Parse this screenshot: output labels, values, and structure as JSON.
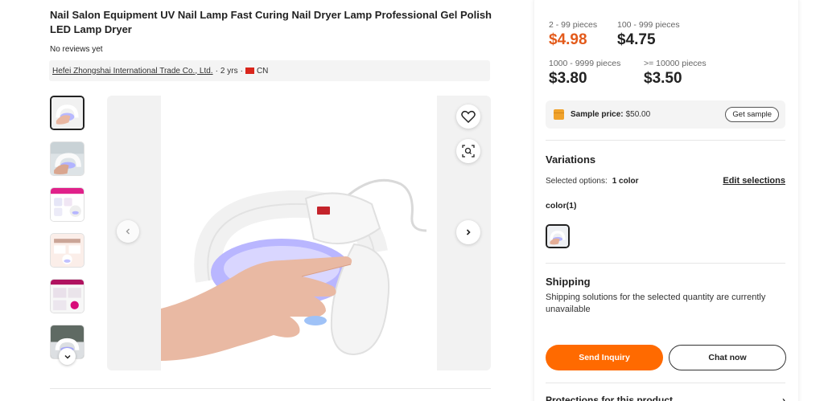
{
  "product": {
    "title": "Nail Salon Equipment UV Nail Lamp Fast Curing Nail Dryer Lamp Professional Gel Polish LED Lamp Dryer",
    "reviews": "No reviews yet"
  },
  "supplier": {
    "name": "Hefei Zhongshai International Trade Co., Ltd.",
    "years": "2 yrs",
    "country": "CN",
    "separator": "·"
  },
  "gallery": {
    "thumbnails": [
      "thumb-1",
      "thumb-2",
      "thumb-3",
      "thumb-4",
      "thumb-5",
      "thumb-6"
    ],
    "selected_index": 0,
    "icons": {
      "favorite": "heart-icon",
      "image_search": "lens-icon",
      "prev": "chevron-left-icon",
      "next": "chevron-right-icon",
      "more": "chevron-down-icon"
    }
  },
  "pricing": {
    "tiers": [
      {
        "range": "2 - 99 pieces",
        "price": "$4.98"
      },
      {
        "range": "100 - 999 pieces",
        "price": "$4.75"
      },
      {
        "range": "1000 - 9999 pieces",
        "price": "$3.80"
      },
      {
        "range": ">= 10000 pieces",
        "price": "$3.50"
      }
    ],
    "accent_color": "#e35a1a"
  },
  "sample": {
    "label": "Sample price:",
    "value": "$50.00",
    "button": "Get sample"
  },
  "variations": {
    "title": "Variations",
    "selected_label": "Selected options:",
    "selected_count": "1 color",
    "edit_label": "Edit selections",
    "color_label": "color(1)"
  },
  "shipping": {
    "title": "Shipping",
    "text": "Shipping solutions for the selected quantity are currently unavailable"
  },
  "actions": {
    "inquiry": "Send Inquiry",
    "chat": "Chat now",
    "primary_color": "#ff6a00"
  },
  "protections": {
    "title": "Protections for this product",
    "chevron": "›"
  }
}
